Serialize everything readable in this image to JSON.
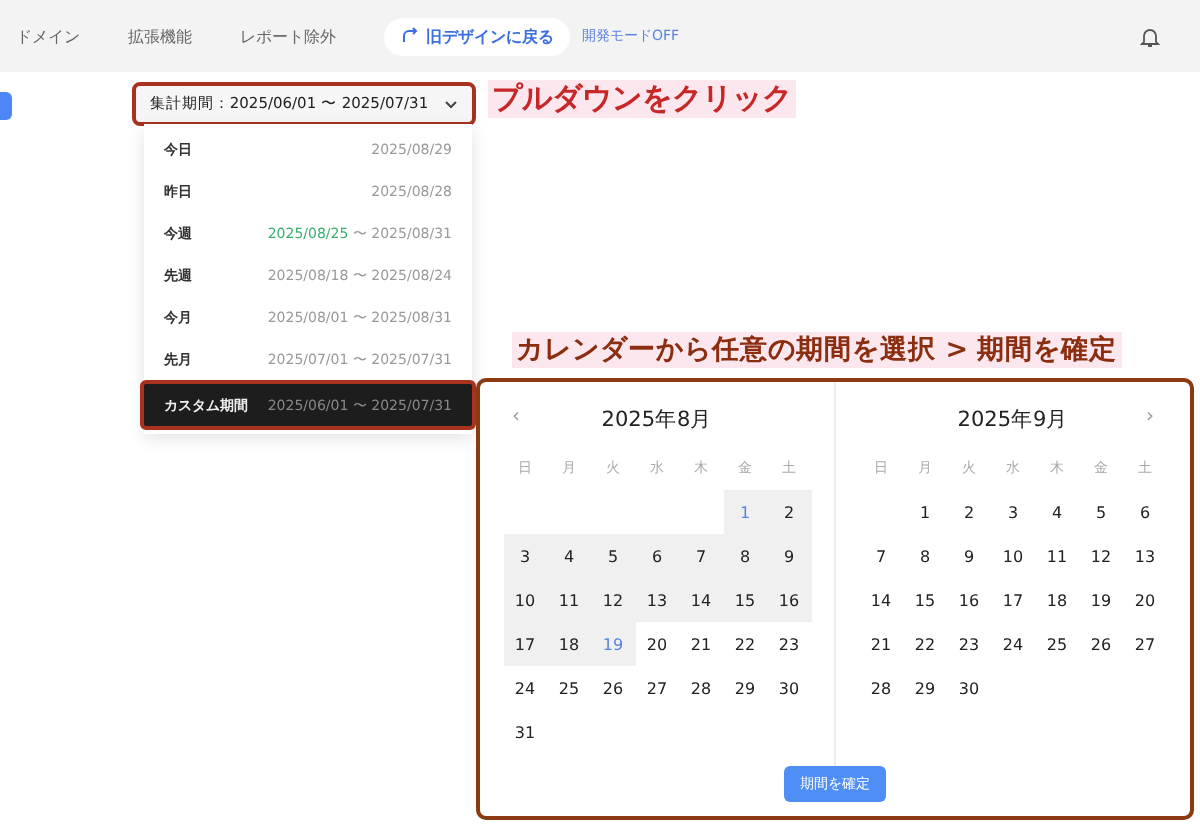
{
  "nav": [
    {
      "label": "ドメイン"
    },
    {
      "label": "拡張機能"
    },
    {
      "label": "レポート除外"
    }
  ],
  "legacy_button": {
    "label": "旧デザインに戻る"
  },
  "dev_mode": {
    "label": "開発モードOFF"
  },
  "period_select": {
    "label": "集計期間：2025/06/01 〜 2025/07/31"
  },
  "annotations": [
    {
      "text": "プルダウンをクリック"
    },
    {
      "text": "カレンダーから任意の期間を選択 > 期間を確定"
    }
  ],
  "period_options": [
    {
      "label": "今日",
      "range": "2025/08/29",
      "selected": false,
      "highlighted": false
    },
    {
      "label": "昨日",
      "range": "2025/08/28",
      "selected": false,
      "highlighted": false
    },
    {
      "label": "今週",
      "range_start": "2025/08/25",
      "range_end": "〜 2025/08/31",
      "selected": false,
      "highlighted": true
    },
    {
      "label": "先週",
      "range": "2025/08/18 〜 2025/08/24",
      "selected": false,
      "highlighted": false
    },
    {
      "label": "今月",
      "range": "2025/08/01 〜 2025/08/31",
      "selected": false,
      "highlighted": false
    },
    {
      "label": "先月",
      "range": "2025/07/01 〜 2025/07/31",
      "selected": false,
      "highlighted": false
    },
    {
      "label": "カスタム期間",
      "range": "2025/06/01 〜 2025/07/31",
      "selected": true,
      "highlighted": false
    }
  ],
  "calendars": [
    {
      "title": "2025年8月",
      "nav": "‹",
      "weekdays": [
        "日",
        "月",
        "火",
        "水",
        "木",
        "金",
        "土"
      ],
      "weeks": [
        [
          {
            "kind": "empty"
          },
          {
            "kind": "empty"
          },
          {
            "kind": "empty"
          },
          {
            "kind": "empty"
          },
          {
            "kind": "empty"
          },
          {
            "kind": "day",
            "label": "1",
            "in_range": true,
            "endpoint": true
          },
          {
            "kind": "day",
            "label": "2",
            "in_range": true,
            "endpoint": false
          }
        ],
        [
          {
            "kind": "day",
            "label": "3",
            "in_range": true,
            "endpoint": false
          },
          {
            "kind": "day",
            "label": "4",
            "in_range": true,
            "endpoint": false
          },
          {
            "kind": "day",
            "label": "5",
            "in_range": true,
            "endpoint": false
          },
          {
            "kind": "day",
            "label": "6",
            "in_range": true,
            "endpoint": false
          },
          {
            "kind": "day",
            "label": "7",
            "in_range": true,
            "endpoint": false
          },
          {
            "kind": "day",
            "label": "8",
            "in_range": true,
            "endpoint": false
          },
          {
            "kind": "day",
            "label": "9",
            "in_range": true,
            "endpoint": false
          }
        ],
        [
          {
            "kind": "day",
            "label": "10",
            "in_range": true,
            "endpoint": false
          },
          {
            "kind": "day",
            "label": "11",
            "in_range": true,
            "endpoint": false
          },
          {
            "kind": "day",
            "label": "12",
            "in_range": true,
            "endpoint": false
          },
          {
            "kind": "day",
            "label": "13",
            "in_range": true,
            "endpoint": false
          },
          {
            "kind": "day",
            "label": "14",
            "in_range": true,
            "endpoint": false
          },
          {
            "kind": "day",
            "label": "15",
            "in_range": true,
            "endpoint": false
          },
          {
            "kind": "day",
            "label": "16",
            "in_range": true,
            "endpoint": false
          }
        ],
        [
          {
            "kind": "day",
            "label": "17",
            "in_range": true,
            "endpoint": false
          },
          {
            "kind": "day",
            "label": "18",
            "in_range": true,
            "endpoint": false
          },
          {
            "kind": "day",
            "label": "19",
            "in_range": true,
            "endpoint": true
          },
          {
            "kind": "day",
            "label": "20",
            "in_range": false,
            "endpoint": false
          },
          {
            "kind": "day",
            "label": "21",
            "in_range": false,
            "endpoint": false
          },
          {
            "kind": "day",
            "label": "22",
            "in_range": false,
            "endpoint": false
          },
          {
            "kind": "day",
            "label": "23",
            "in_range": false,
            "endpoint": false
          }
        ],
        [
          {
            "kind": "day",
            "label": "24",
            "in_range": false,
            "endpoint": false
          },
          {
            "kind": "day",
            "label": "25",
            "in_range": false,
            "endpoint": false
          },
          {
            "kind": "day",
            "label": "26",
            "in_range": false,
            "endpoint": false
          },
          {
            "kind": "day",
            "label": "27",
            "in_range": false,
            "endpoint": false
          },
          {
            "kind": "day",
            "label": "28",
            "in_range": false,
            "endpoint": false
          },
          {
            "kind": "day",
            "label": "29",
            "in_range": false,
            "endpoint": false
          },
          {
            "kind": "day",
            "label": "30",
            "in_range": false,
            "endpoint": false
          }
        ],
        [
          {
            "kind": "day",
            "label": "31",
            "in_range": false,
            "endpoint": false
          }
        ]
      ]
    },
    {
      "title": "2025年9月",
      "nav": "›",
      "weekdays": [
        "日",
        "月",
        "火",
        "水",
        "木",
        "金",
        "土"
      ],
      "weeks": [
        [
          {
            "kind": "empty"
          },
          {
            "kind": "day",
            "label": "1",
            "in_range": false,
            "endpoint": false
          },
          {
            "kind": "day",
            "label": "2",
            "in_range": false,
            "endpoint": false
          },
          {
            "kind": "day",
            "label": "3",
            "in_range": false,
            "endpoint": false
          },
          {
            "kind": "day",
            "label": "4",
            "in_range": false,
            "endpoint": false
          },
          {
            "kind": "day",
            "label": "5",
            "in_range": false,
            "endpoint": false
          },
          {
            "kind": "day",
            "label": "6",
            "in_range": false,
            "endpoint": false
          }
        ],
        [
          {
            "kind": "day",
            "label": "7",
            "in_range": false,
            "endpoint": false
          },
          {
            "kind": "day",
            "label": "8",
            "in_range": false,
            "endpoint": false
          },
          {
            "kind": "day",
            "label": "9",
            "in_range": false,
            "endpoint": false
          },
          {
            "kind": "day",
            "label": "10",
            "in_range": false,
            "endpoint": false
          },
          {
            "kind": "day",
            "label": "11",
            "in_range": false,
            "endpoint": false
          },
          {
            "kind": "day",
            "label": "12",
            "in_range": false,
            "endpoint": false
          },
          {
            "kind": "day",
            "label": "13",
            "in_range": false,
            "endpoint": false
          }
        ],
        [
          {
            "kind": "day",
            "label": "14",
            "in_range": false,
            "endpoint": false
          },
          {
            "kind": "day",
            "label": "15",
            "in_range": false,
            "endpoint": false
          },
          {
            "kind": "day",
            "label": "16",
            "in_range": false,
            "endpoint": false
          },
          {
            "kind": "day",
            "label": "17",
            "in_range": false,
            "endpoint": false
          },
          {
            "kind": "day",
            "label": "18",
            "in_range": false,
            "endpoint": false
          },
          {
            "kind": "day",
            "label": "19",
            "in_range": false,
            "endpoint": false
          },
          {
            "kind": "day",
            "label": "20",
            "in_range": false,
            "endpoint": false
          }
        ],
        [
          {
            "kind": "day",
            "label": "21",
            "in_range": false,
            "endpoint": false
          },
          {
            "kind": "day",
            "label": "22",
            "in_range": false,
            "endpoint": false
          },
          {
            "kind": "day",
            "label": "23",
            "in_range": false,
            "endpoint": false
          },
          {
            "kind": "day",
            "label": "24",
            "in_range": false,
            "endpoint": false
          },
          {
            "kind": "day",
            "label": "25",
            "in_range": false,
            "endpoint": false
          },
          {
            "kind": "day",
            "label": "26",
            "in_range": false,
            "endpoint": false
          },
          {
            "kind": "day",
            "label": "27",
            "in_range": false,
            "endpoint": false
          }
        ],
        [
          {
            "kind": "day",
            "label": "28",
            "in_range": false,
            "endpoint": false
          },
          {
            "kind": "day",
            "label": "29",
            "in_range": false,
            "endpoint": false
          },
          {
            "kind": "day",
            "label": "30",
            "in_range": false,
            "endpoint": false
          }
        ]
      ]
    }
  ],
  "confirm_button": {
    "label": "期間を確定"
  }
}
